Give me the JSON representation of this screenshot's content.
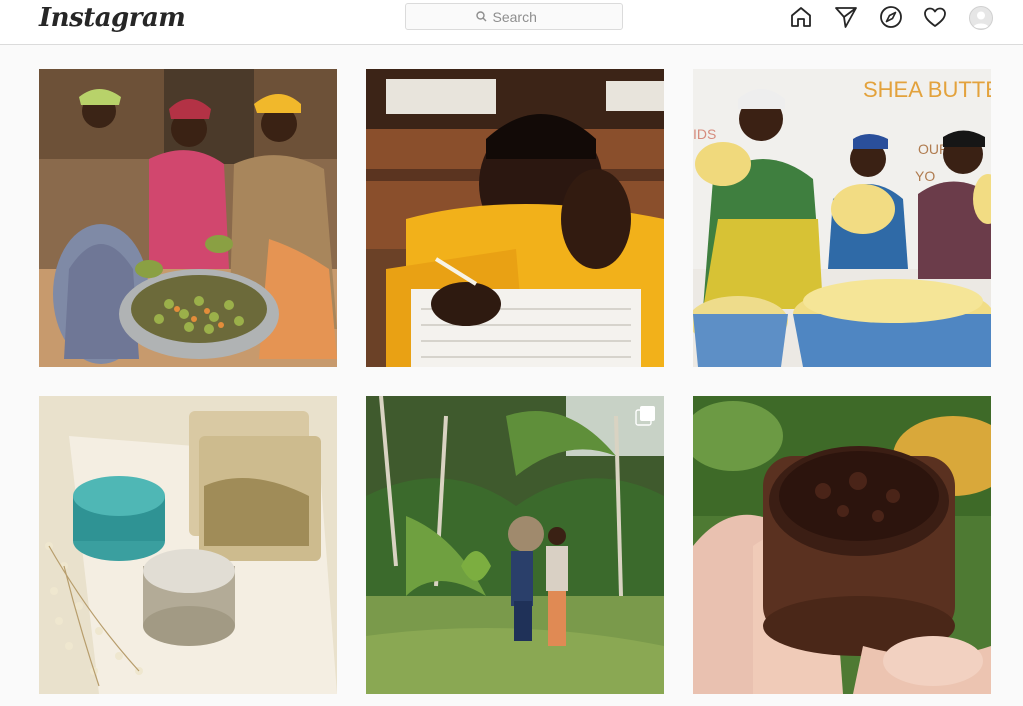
{
  "header": {
    "logo_text": "Instagram",
    "search": {
      "placeholder": "Search",
      "icon": "search-icon"
    },
    "nav_icons": [
      "home-icon",
      "explore-send-icon",
      "compass-icon",
      "heart-icon",
      "profile-avatar"
    ]
  },
  "posts": [
    {
      "name": "post-women-shea-nuts",
      "alt": ""
    },
    {
      "name": "post-smiling-student",
      "alt": ""
    },
    {
      "name": "post-shea-butter-women",
      "alt": "",
      "banner_text": "SHEA BUTTER",
      "side_text": "IDS",
      "partial_text": "OUR",
      "partial_text2": "YO"
    },
    {
      "name": "post-soap-and-jars",
      "alt": ""
    },
    {
      "name": "post-farm-workers",
      "alt": "",
      "badge": "multiple-posts-icon"
    },
    {
      "name": "post-dark-shea-jar",
      "alt": ""
    }
  ],
  "colors": {
    "header_bg": "#ffffff",
    "page_bg": "#fafafa",
    "border": "#dbdbdb",
    "icon": "#262626"
  }
}
